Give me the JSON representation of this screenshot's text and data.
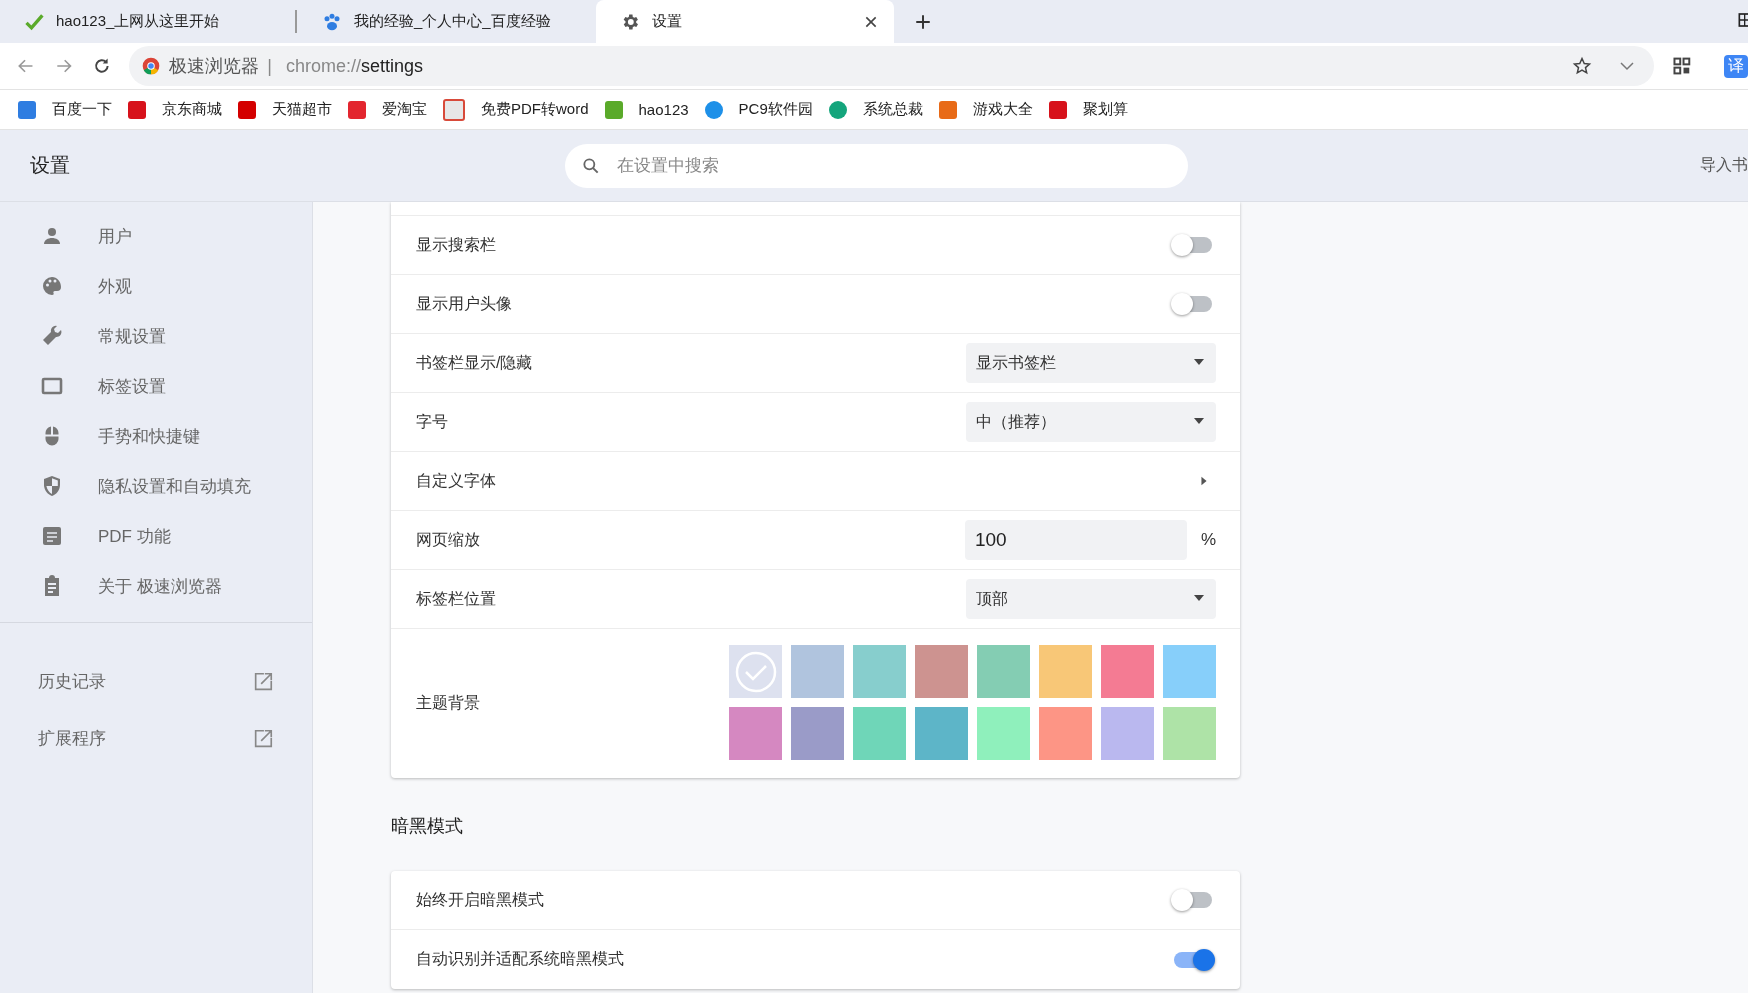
{
  "tabs": [
    {
      "title": "hao123_上网从这里开始",
      "selected": false
    },
    {
      "title": "我的经验_个人中心_百度经验",
      "selected": false
    },
    {
      "title": "设置",
      "selected": true
    }
  ],
  "address_bar": {
    "browser_name": "极速浏览器",
    "separator": "|",
    "url_scheme": "chrome://",
    "url_path": "settings"
  },
  "toolbar": {
    "translate_label": "译"
  },
  "bookmarks": [
    "百度一下",
    "京东商城",
    "天猫超市",
    "爱淘宝",
    "免费PDF转word",
    "hao123",
    "PC9软件园",
    "系统总裁",
    "游戏大全",
    "聚划算"
  ],
  "header": {
    "title": "设置",
    "search": {
      "placeholder": "在设置中搜索"
    },
    "import_link": "导入书"
  },
  "sidebar": {
    "items": [
      {
        "label": "用户",
        "selected": false
      },
      {
        "label": "外观",
        "selected": false
      },
      {
        "label": "常规设置",
        "selected": false
      },
      {
        "label": "标签设置",
        "selected": false
      },
      {
        "label": "手势和快捷键",
        "selected": false
      },
      {
        "label": "隐私设置和自动填充",
        "selected": false
      },
      {
        "label": "PDF 功能",
        "selected": false
      },
      {
        "label": "关于 极速浏览器",
        "selected": false
      }
    ],
    "links": [
      {
        "label": "历史记录"
      },
      {
        "label": "扩展程序"
      }
    ]
  },
  "appearance": {
    "rows": [
      {
        "kind": "toggle",
        "label": "显示搜索栏",
        "on": false
      },
      {
        "kind": "toggle",
        "label": "显示用户头像",
        "on": false
      },
      {
        "kind": "select",
        "label": "书签栏显示/隐藏",
        "value": "显示书签栏"
      },
      {
        "kind": "select",
        "label": "字号",
        "value": "中（推荐）"
      },
      {
        "kind": "link",
        "label": "自定义字体"
      },
      {
        "kind": "number",
        "label": "网页缩放",
        "value": "100",
        "unit": "%"
      },
      {
        "kind": "select",
        "label": "标签栏位置",
        "value": "顶部"
      },
      {
        "kind": "swatches",
        "label": "主题背景",
        "swatches": [
          {
            "color": "#dde1ef",
            "selected": true
          },
          {
            "color": "#b0c4de",
            "selected": false
          },
          {
            "color": "#87cecd",
            "selected": false
          },
          {
            "color": "#cd9390",
            "selected": false
          },
          {
            "color": "#84cdb3",
            "selected": false
          },
          {
            "color": "#f8c777",
            "selected": false
          },
          {
            "color": "#f47b93",
            "selected": false
          },
          {
            "color": "#87cffa",
            "selected": false
          },
          {
            "color": "#d588c1",
            "selected": false
          },
          {
            "color": "#9a9bc8",
            "selected": false
          },
          {
            "color": "#6fd6b8",
            "selected": false
          },
          {
            "color": "#5db5c8",
            "selected": false
          },
          {
            "color": "#8ff0bc",
            "selected": false
          },
          {
            "color": "#fd9585",
            "selected": false
          },
          {
            "color": "#bab8ef",
            "selected": false
          },
          {
            "color": "#aee3a7",
            "selected": false
          }
        ]
      }
    ]
  },
  "dark_mode": {
    "title": "暗黑模式",
    "rows": [
      {
        "kind": "toggle",
        "label": "始终开启暗黑模式",
        "on": false
      },
      {
        "kind": "toggle",
        "label": "自动识别并适配系统暗黑模式",
        "on": true
      }
    ]
  }
}
